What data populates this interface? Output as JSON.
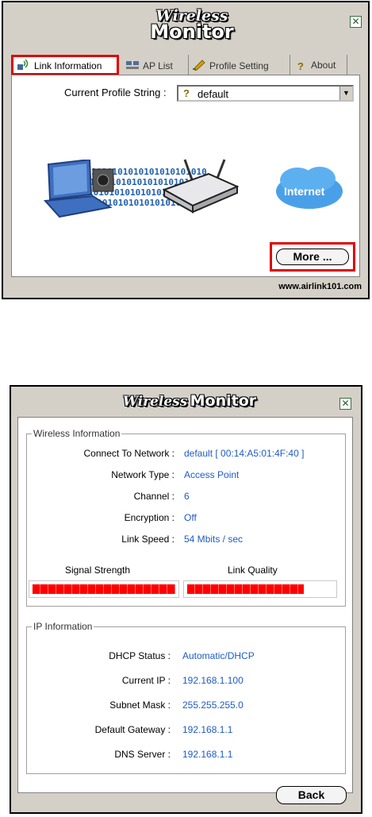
{
  "window1": {
    "logo_line1": "Wireless",
    "logo_line2": "Monitor",
    "close_glyph": "✕",
    "tabs": [
      {
        "label": "Link Information",
        "icon": "signal-icon"
      },
      {
        "label": "AP List",
        "icon": "network-icon"
      },
      {
        "label": "Profile Setting",
        "icon": "pencil-icon"
      },
      {
        "label": "About",
        "icon": "question-icon"
      }
    ],
    "profile_label": "Current Profile String :",
    "profile_value": "default",
    "scene": {
      "internet_label": "Internet",
      "bits_text": "1010101010101010101010"
    },
    "more_label": "More ...",
    "footer_url": "www.airlink101.com"
  },
  "window2": {
    "logo_line1": "Wireless",
    "logo_line2": "Monitor",
    "close_glyph": "✕",
    "wireless_info": {
      "title": "Wireless Information",
      "rows": [
        {
          "label": "Connect To Network :",
          "value": "default [ 00:14:A5:01:4F:40 ]"
        },
        {
          "label": "Network Type :",
          "value": "Access Point"
        },
        {
          "label": "Channel :",
          "value": "6"
        },
        {
          "label": "Encryption :",
          "value": "Off"
        },
        {
          "label": "Link Speed :",
          "value": "54 Mbits / sec"
        }
      ],
      "signal_label": "Signal Strength",
      "signal_level": 1.0,
      "quality_label": "Link Quality",
      "quality_level": 0.8
    },
    "ip_info": {
      "title": "IP Information",
      "rows": [
        {
          "label": "DHCP Status :",
          "value": "Automatic/DHCP"
        },
        {
          "label": "Current IP :",
          "value": "192.168.1.100"
        },
        {
          "label": "Subnet Mask :",
          "value": "255.255.255.0"
        },
        {
          "label": "Default Gateway :",
          "value": "192.168.1.1"
        },
        {
          "label": "DNS Server :",
          "value": "192.168.1.1"
        }
      ]
    },
    "back_label": "Back"
  },
  "colors": {
    "window_bg": "#d4d0c8",
    "highlight_red": "#e00000",
    "value_blue": "#1e5bc6",
    "meter_red": "#ff0000"
  }
}
